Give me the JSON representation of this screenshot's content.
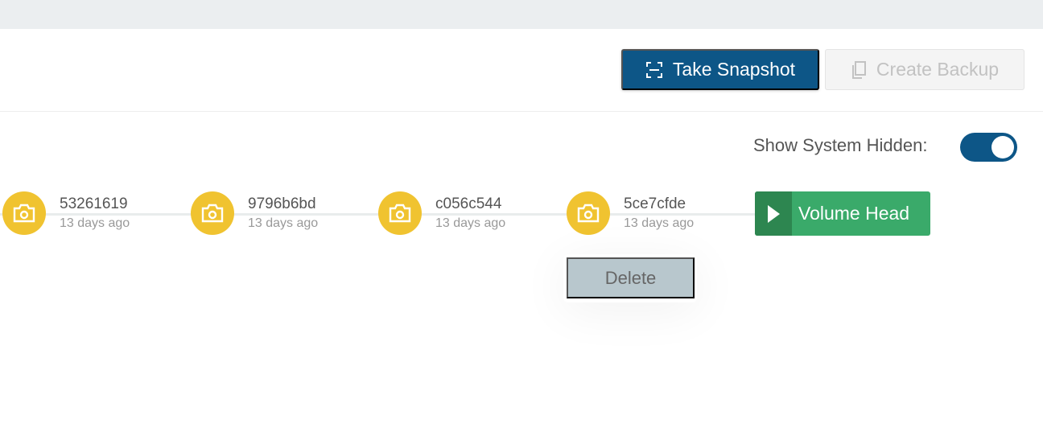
{
  "toolbar": {
    "take_snapshot": "Take Snapshot",
    "create_backup": "Create Backup"
  },
  "filter": {
    "show_system_hidden_label": "Show System Hidden:",
    "show_system_hidden": true
  },
  "snapshots": [
    {
      "id": "53261619",
      "time": "13 days ago"
    },
    {
      "id": "9796b6bd",
      "time": "13 days ago"
    },
    {
      "id": "c056c544",
      "time": "13 days ago"
    },
    {
      "id": "5ce7cfde",
      "time": "13 days ago"
    }
  ],
  "volume_head": "Volume Head",
  "context_menu": {
    "delete": "Delete"
  },
  "colors": {
    "primary": "#0d5687",
    "snapshot": "#f0c330",
    "head": "#3aaa6a"
  }
}
